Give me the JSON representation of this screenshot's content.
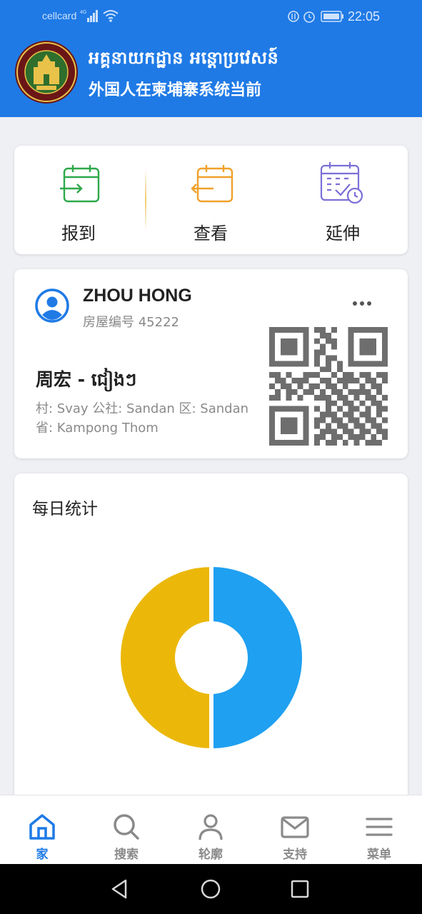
{
  "status_bar": {
    "carrier": "cellcard",
    "network": "4G",
    "time": "22:05"
  },
  "header": {
    "title_khmer": "អគ្គនាយកដ្ឋាន អន្តោប្រវេសន៍",
    "title_chinese": "外国人在柬埔寨系统当前",
    "logo_text": "GENERAL DEPARTMENT OF IMMIGRATION",
    "accent_color": "#1f7ae6"
  },
  "actions": [
    {
      "label": "报到",
      "icon": "calendar-checkin-icon",
      "color": "#2ea84a"
    },
    {
      "label": "查看",
      "icon": "calendar-checkout-icon",
      "color": "#f0a12a"
    },
    {
      "label": "延伸",
      "icon": "calendar-extend-icon",
      "color": "#7b6fd6"
    }
  ],
  "profile": {
    "name": "ZHOU HONG",
    "house_number": "房屋编号 45222",
    "native_name": "周宏 - ជៀងៗ",
    "address_line1": "村: Svay 公社: Sandan 区: Sandan",
    "address_line2": "省: Kampong Thom"
  },
  "daily_stats": {
    "title": "每日统计"
  },
  "chart_data": {
    "type": "pie",
    "categories": [
      "",
      ""
    ],
    "values": [
      50,
      50
    ],
    "colors": [
      "#1fa0f0",
      "#ebb80a"
    ],
    "title": "每日统计",
    "donut": true
  },
  "bottom_nav": [
    {
      "label": "家",
      "icon": "home-icon",
      "active": true
    },
    {
      "label": "搜索",
      "icon": "search-icon",
      "active": false
    },
    {
      "label": "轮廓",
      "icon": "profile-icon",
      "active": false
    },
    {
      "label": "支持",
      "icon": "mail-icon",
      "active": false
    },
    {
      "label": "菜单",
      "icon": "menu-icon",
      "active": false
    }
  ]
}
